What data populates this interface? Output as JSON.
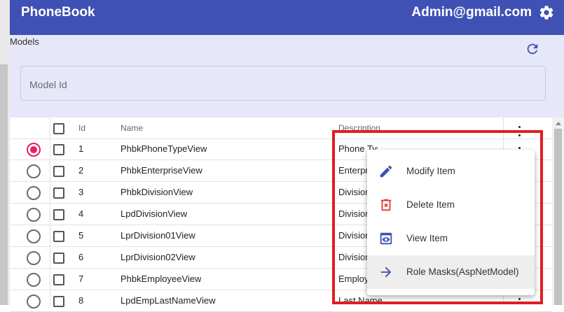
{
  "header": {
    "title": "PhoneBook",
    "user": "Admin@gmail.com"
  },
  "panel": {
    "section_label": "Models",
    "model_id_placeholder": "Model Id"
  },
  "table": {
    "columns": {
      "id": "Id",
      "name": "Name",
      "description": "Description"
    },
    "rows": [
      {
        "id": "1",
        "name": "PhbkPhoneTypeView",
        "description": "Phone Type",
        "selected": true
      },
      {
        "id": "2",
        "name": "PhbkEnterpriseView",
        "description": "Enterprise",
        "selected": false
      },
      {
        "id": "3",
        "name": "PhbkDivisionView",
        "description": "Division",
        "selected": false
      },
      {
        "id": "4",
        "name": "LpdDivisionView",
        "description": "Division",
        "selected": false
      },
      {
        "id": "5",
        "name": "LprDivision01View",
        "description": "Division",
        "selected": false
      },
      {
        "id": "6",
        "name": "LprDivision02View",
        "description": "Division",
        "selected": false
      },
      {
        "id": "7",
        "name": "PhbkEmployeeView",
        "description": "Employee",
        "selected": false
      },
      {
        "id": "8",
        "name": "LpdEmpLastNameView",
        "description": "Last Name",
        "selected": false
      }
    ]
  },
  "context_menu": {
    "items": [
      {
        "label": "Modify Item",
        "icon": "pencil-icon"
      },
      {
        "label": "Delete Item",
        "icon": "delete-icon"
      },
      {
        "label": "View Item",
        "icon": "eye-icon"
      },
      {
        "label": "Role Masks(AspNetModel)",
        "icon": "arrow-right-icon"
      }
    ]
  },
  "colors": {
    "primary": "#3f51b5",
    "panel_bg": "#e6e7f8",
    "accent": "#e91e63",
    "highlight_border": "#e01e24",
    "delete_icon": "#e53935"
  }
}
